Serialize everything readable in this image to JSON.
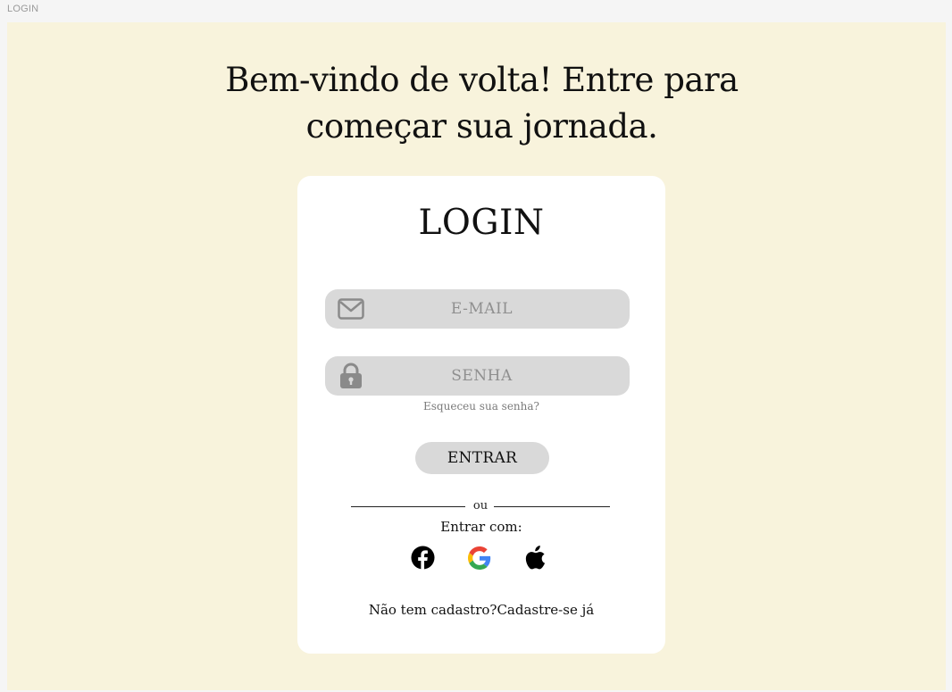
{
  "frame": {
    "label": "LOGIN"
  },
  "header": {
    "welcome_line1": "Bem-vindo de volta! Entre para",
    "welcome_line2": "começar sua jornada."
  },
  "login_card": {
    "title": "LOGIN",
    "email": {
      "placeholder": "E-MAIL",
      "value": "",
      "icon": "mail-icon"
    },
    "password": {
      "placeholder": "SENHA",
      "value": "",
      "icon": "lock-icon"
    },
    "forgot_password_label": "Esqueceu sua senha?",
    "submit_label": "ENTRAR",
    "divider_label": "ou",
    "social_label": "Entrar com:",
    "social_providers": [
      {
        "name": "facebook",
        "icon": "facebook-icon"
      },
      {
        "name": "google",
        "icon": "google-icon"
      },
      {
        "name": "apple",
        "icon": "apple-icon"
      }
    ],
    "signup_prompt": "Não tem cadastro?",
    "signup_link": "Cadastre-se já"
  },
  "colors": {
    "page_background": "#f5f5f5",
    "canvas_background": "#f8f3dc",
    "card_background": "#ffffff",
    "field_background": "#d9d9d9",
    "placeholder_text": "#8f8f8f",
    "text": "#111111",
    "facebook": "#000000",
    "google_blue": "#4285F4",
    "google_red": "#EA4335",
    "google_yellow": "#FBBC05",
    "google_green": "#34A853"
  }
}
